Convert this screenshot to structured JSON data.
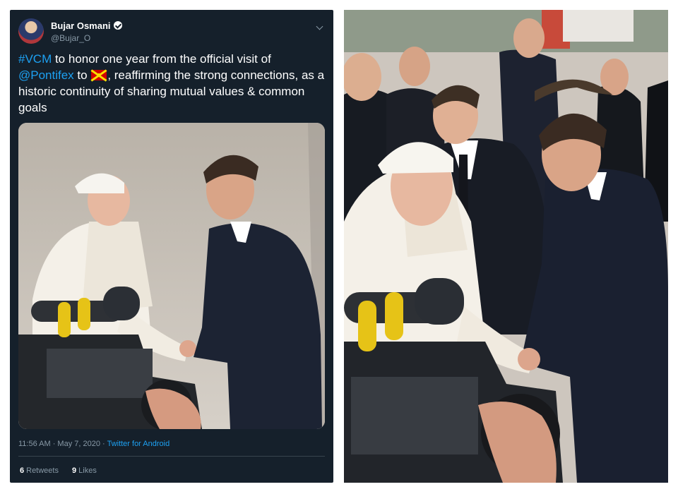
{
  "tweet": {
    "author": {
      "name": "Bujar Osmani",
      "handle": "@Bujar_O"
    },
    "text": {
      "hashtag": "#VCM",
      "part1": " to honor one year from the official visit of ",
      "mention": "@Pontifex",
      "part2": " to ",
      "part3": ", reaffirming the strong connections, as a historic continuity of sharing mutual values & common goals"
    },
    "timestamp": "11:56 AM · May 7, 2020 · ",
    "source": "Twitter for Android",
    "stats": {
      "retweets_count": "6",
      "retweets_label": "Retweets",
      "likes_count": "9",
      "likes_label": "Likes"
    }
  },
  "icons": {
    "verified": "verified-badge-icon",
    "caret": "chevron-down-icon",
    "flag": "north-macedonia-flag-emoji"
  },
  "colors": {
    "tweet_background": "#15202b",
    "link": "#1da1f2",
    "secondary_text": "#8899a6"
  }
}
